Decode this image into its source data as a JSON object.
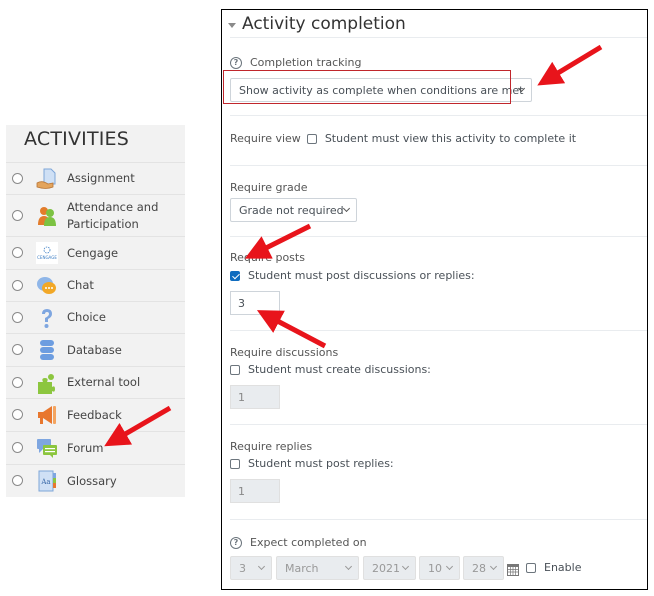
{
  "activities": {
    "title": "ACTIVITIES",
    "items": [
      {
        "label": "Assignment",
        "icon": "assignment-icon"
      },
      {
        "label": "Attendance and Participation",
        "label_line1": "Attendance and",
        "label_line2": "Participation",
        "icon": "attendance-icon"
      },
      {
        "label": "Cengage",
        "icon": "cengage-icon",
        "icon_text": "CENGAGE"
      },
      {
        "label": "Chat",
        "icon": "chat-icon"
      },
      {
        "label": "Choice",
        "icon": "choice-icon"
      },
      {
        "label": "Database",
        "icon": "database-icon"
      },
      {
        "label": "External tool",
        "icon": "external-tool-icon"
      },
      {
        "label": "Feedback",
        "icon": "feedback-icon"
      },
      {
        "label": "Forum",
        "icon": "forum-icon"
      },
      {
        "label": "Glossary",
        "icon": "glossary-icon",
        "icon_text": "Aa"
      }
    ]
  },
  "form": {
    "section_title": "Activity completion",
    "completion_tracking": {
      "label": "Completion tracking",
      "help_glyph": "?",
      "selected": "Show activity as complete when conditions are met"
    },
    "require_view": {
      "label": "Require view",
      "checkbox_label": "Student must view this activity to complete it",
      "checked": false
    },
    "require_grade": {
      "label": "Require grade",
      "selected": "Grade not required"
    },
    "require_posts": {
      "label": "Require posts",
      "checkbox_label": "Student must post discussions or replies:",
      "checked": true,
      "value": "3"
    },
    "require_discussions": {
      "label": "Require discussions",
      "checkbox_label": "Student must create discussions:",
      "checked": false,
      "value": "1"
    },
    "require_replies": {
      "label": "Require replies",
      "checkbox_label": "Student must post replies:",
      "checked": false,
      "value": "1"
    },
    "expect_completed": {
      "label": "Expect completed on",
      "help_glyph": "?",
      "day": "3",
      "month": "March",
      "year": "2021",
      "hour": "10",
      "minute": "28",
      "enable_label": "Enable",
      "enabled": false
    }
  },
  "annotations": {
    "arrow_color": "#e8141b",
    "highlight_color": "#c0262c"
  }
}
